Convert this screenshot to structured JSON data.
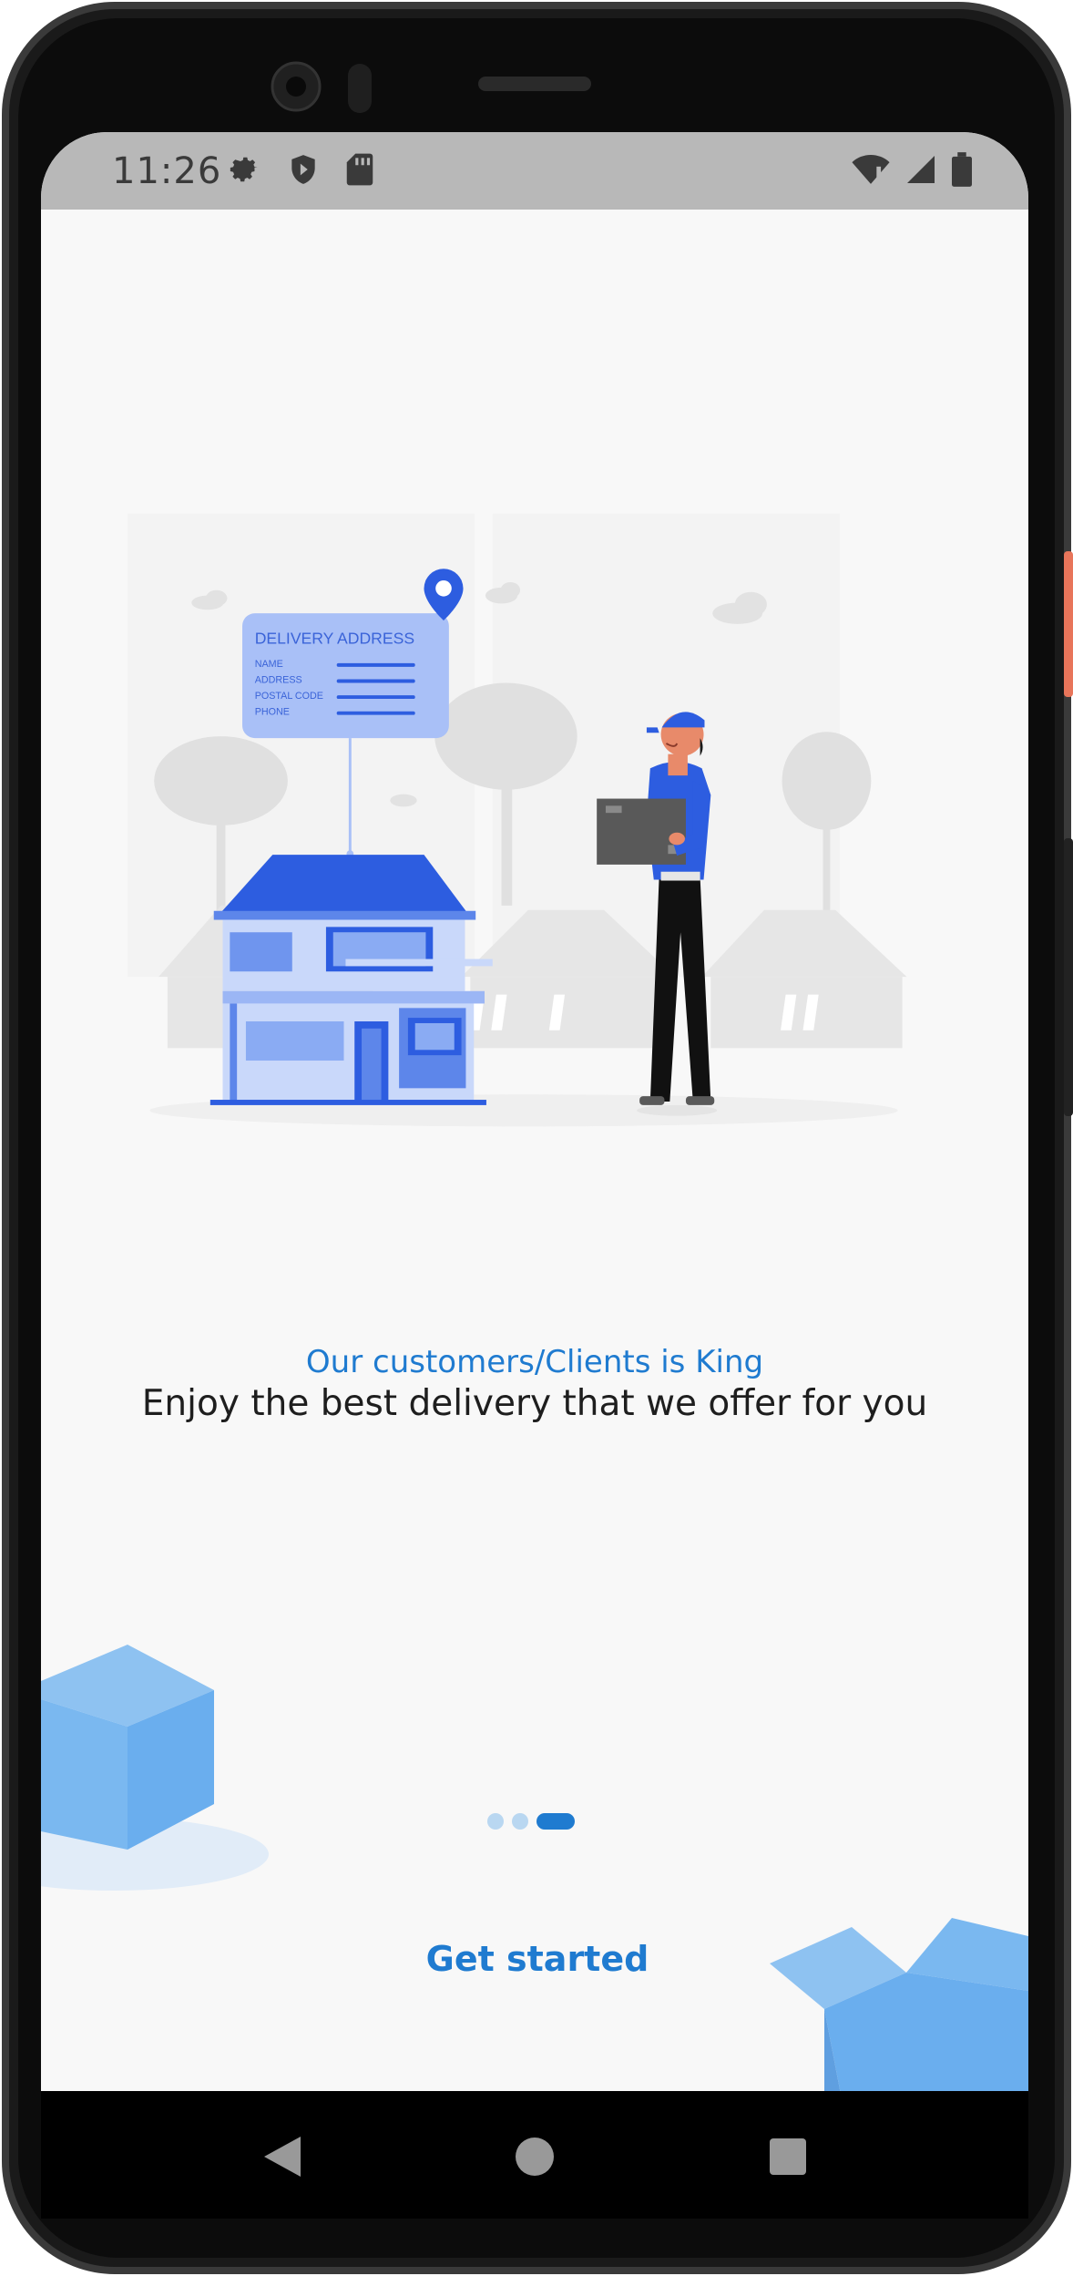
{
  "status_bar": {
    "time": "11:26",
    "icons_left": [
      "gear-icon",
      "shield-icon",
      "sd-card-icon"
    ],
    "icons_right": [
      "wifi-icon",
      "signal-icon",
      "battery-icon"
    ]
  },
  "illustration": {
    "card_title": "DELIVERY ADDRESS",
    "card_fields": [
      "NAME",
      "ADDRESS",
      "POSTAL CODE",
      "PHONE"
    ]
  },
  "onboarding": {
    "tagline": "Our customers/Clients is King",
    "headline": "Enjoy the best delivery that we offer for you",
    "pages_total": 3,
    "current_page": 3,
    "cta_label": "Get started"
  },
  "nav": {
    "icons": [
      "back-icon",
      "home-icon",
      "recents-icon"
    ]
  },
  "colors": {
    "accent": "#1f7bd0",
    "status_bar": "#b8b8b8",
    "background": "#f8f8f8"
  }
}
